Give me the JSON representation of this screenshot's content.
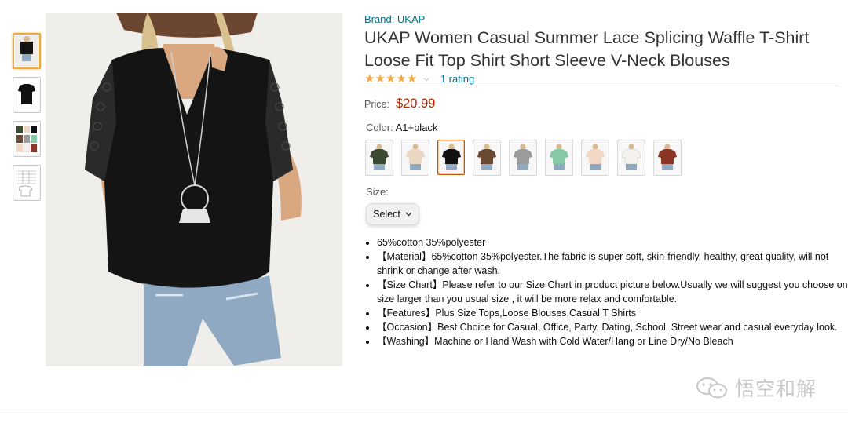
{
  "product": {
    "brand": "Brand: UKAP",
    "title": "UKAP Women Casual Summer Lace Splicing Waffle T-Shirt Loose Fit Top Shirt Short Sleeve V-Neck Blouses",
    "stars": "★★★★★",
    "rating_count": "1 rating",
    "price_label": "Price:",
    "price": "$20.99",
    "color_label": "Color: ",
    "color_value": "A1+black",
    "size_label": "Size:",
    "size_select": "Select"
  },
  "swatches": [
    {
      "name": "dark green",
      "color": "#3d4a32"
    },
    {
      "name": "beige",
      "color": "#e9d7c3"
    },
    {
      "name": "black",
      "color": "#111111"
    },
    {
      "name": "brown",
      "color": "#6b4a34"
    },
    {
      "name": "gray",
      "color": "#9b9b9b"
    },
    {
      "name": "mint green",
      "color": "#86c9a5"
    },
    {
      "name": "apricot",
      "color": "#f2d7c4"
    },
    {
      "name": "white",
      "color": "#f4f1ee"
    },
    {
      "name": "rust",
      "color": "#8c3524"
    }
  ],
  "bullets": [
    "65%cotton 35%polyester",
    "【Material】65%cotton 35%polyester.The fabric is super soft, skin-friendly, healthy, great quality, will not shrink or change after wash.",
    "【Size Chart】Please refer to our Size Chart in product picture below.Usually we will suggest you choose one size larger than you usual size , it will be more relax and comfortable.",
    "【Features】Plus Size Tops,Loose Blouses,Casual T Shirts",
    "【Occasion】Best Choice for Casual, Office, Party, Dating, School, Street wear and casual everyday look.",
    "【Washing】Machine or Hand Wash with Cold Water/Hang or Line Dry/No Bleach"
  ],
  "watermark": "悟空和解",
  "icons": {
    "share": "share-icon",
    "chevron": "chevron-down-icon",
    "watermark_logo": "wechat-logo-icon"
  },
  "colors": {
    "link": "#007185",
    "price": "#b12704",
    "star": "#f3a847",
    "selected_border": "#c45500",
    "thumb_active_border": "#f0a742"
  }
}
